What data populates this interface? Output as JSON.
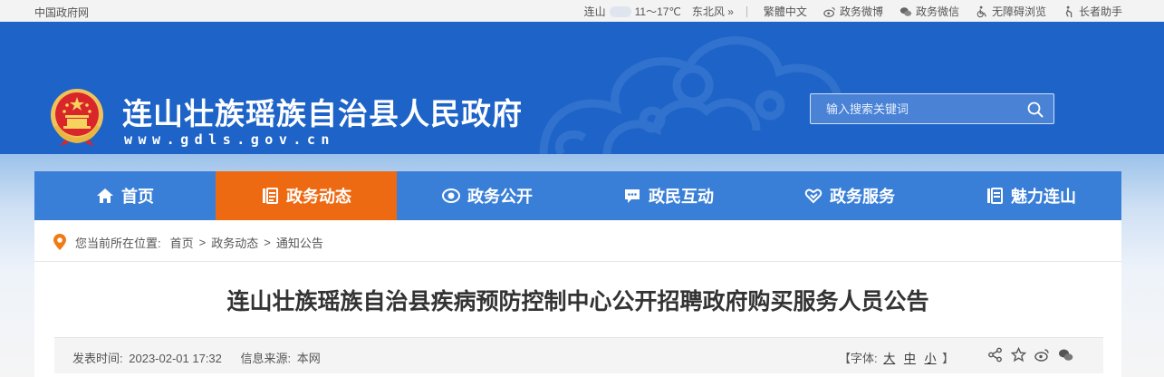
{
  "topbar": {
    "site_name": "中国政府网",
    "city": "连山",
    "temperature": "11～17℃",
    "wind": "东北风 »",
    "traditional": "繁體中文",
    "weibo": "政务微博",
    "wechat": "政务微信",
    "accessibility": "无障碍浏览",
    "elder": "长者助手"
  },
  "header": {
    "title": "连山壮族瑶族自治县人民政府",
    "domain": "www.gdls.gov.cn",
    "search_placeholder": "输入搜索关键词"
  },
  "nav": {
    "items": [
      {
        "label": "首页",
        "icon": "home-icon"
      },
      {
        "label": "政务动态",
        "icon": "list-icon"
      },
      {
        "label": "政务公开",
        "icon": "eye-icon"
      },
      {
        "label": "政民互动",
        "icon": "chat-icon"
      },
      {
        "label": "政务服务",
        "icon": "heart-hand-icon"
      },
      {
        "label": "魅力连山",
        "icon": "book-icon"
      }
    ],
    "active_index": 1
  },
  "breadcrumb": {
    "prefix": "您当前所在位置:",
    "items": [
      "首页",
      "政务动态",
      "通知公告"
    ],
    "separator": ">"
  },
  "article": {
    "title": "连山壮族瑶族自治县疾病预防控制中心公开招聘政府购买服务人员公告",
    "publish_label": "发表时间:",
    "publish_time": "2023-02-01 17:32",
    "source_label": "信息来源:",
    "source": "本网",
    "font_label": "【字体:",
    "font_large": "大",
    "font_medium": "中",
    "font_small": "小",
    "font_close": "】"
  },
  "colors": {
    "header_blue": "#1e63c7",
    "nav_blue": "#3a7fd7",
    "active_orange": "#ee6a12",
    "pin_orange": "#f07b16"
  }
}
